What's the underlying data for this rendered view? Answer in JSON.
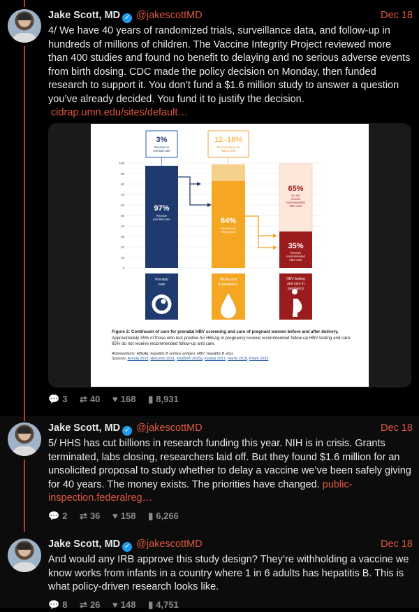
{
  "posts": [
    {
      "author": "Jake Scott, MD",
      "handle": "@jakescottMD",
      "date": "Dec 18",
      "text": "4/ We have 40 years of randomized trials, surveillance data, and follow-up in hundreds of millions of children. The Vaccine Integrity Project reviewed more than 400 studies and found no benefit to delaying and no serious adverse events from birth dosing. CDC made the policy decision on Monday, then funded research to support it. You don’t fund a $1.6 million study to answer a question you’ve already decided. You fund it to justify the decision.",
      "link": "cidrap.umn.edu/sites/default…",
      "stats": {
        "replies": "3",
        "reposts": "40",
        "likes": "168",
        "views": "8,931"
      }
    },
    {
      "author": "Jake Scott, MD",
      "handle": "@jakescottMD",
      "date": "Dec 18",
      "text": "5/ HHS has cut billions in research funding this year. NIH is in crisis. Grants terminated, labs closing, researchers laid off. But they found $1.6 million for an unsolicited proposal to study whether to delay a vaccine we’ve been safely giving for 40 years. The money exists. The priorities have changed.",
      "link": "public-inspection.federalreg…",
      "stats": {
        "replies": "2",
        "reposts": "36",
        "likes": "158",
        "views": "6,266"
      }
    },
    {
      "author": "Jake Scott, MD",
      "handle": "@jakescottMD",
      "date": "Dec 18",
      "text": "And would any IRB approve this study design? They’re withholding a vaccine we know works from infants in a country where 1 in 6 adults has hepatitis B. This is what policy-driven research looks like.",
      "stats": {
        "replies": "8",
        "reposts": "26",
        "likes": "148",
        "views": "4,751"
      }
    }
  ],
  "figure": {
    "top_boxes": [
      {
        "value": "3%",
        "label": "Receive no prenatal care"
      },
      {
        "value": "12–18%",
        "label": "Do not receive an HBsAg test"
      }
    ],
    "bars": [
      {
        "value": "97%",
        "label": "Receive prenatal care"
      },
      {
        "value": "84%",
        "label": "Receive an HBsAg test"
      },
      {
        "value": "65%",
        "label": "Do not receive recommended HBV care"
      },
      {
        "value": "35%",
        "label": "Receive recommended HBV care"
      }
    ],
    "y_ticks": [
      "100",
      "90",
      "80",
      "70",
      "60",
      "50",
      "40",
      "30",
      "20",
      "10",
      "0"
    ],
    "bottom_boxes": [
      "Prenatal care",
      "HBsAg test in pregnancy",
      "HBV testing and care in pregnancy"
    ],
    "caption_title": "Figure 2: Continuum of care for prenatal HBV screening and care of pregnant women before and after delivery.",
    "caption_body": "Approximately 35% of those who test positive for HBsAg in pregnancy receive recommended follow-up HBV testing and care; 65% do not receive recommended follow-up and care.",
    "abbreviations": "Abbreviations: HBsAg: hepatitis B surface antigen; HBV: hepatitis B virus",
    "sources_label": "Sources:",
    "sources": [
      "Avoola 2010",
      "Holcomb 2021",
      "McElfish 2025a",
      "Kolasa 2017",
      "Harris 2018",
      "Pham 2023"
    ]
  },
  "colors": {
    "accent": "#e0573f",
    "navy": "#1f3a6e",
    "orange": "#f5a623",
    "darkred": "#9b1c1c"
  }
}
